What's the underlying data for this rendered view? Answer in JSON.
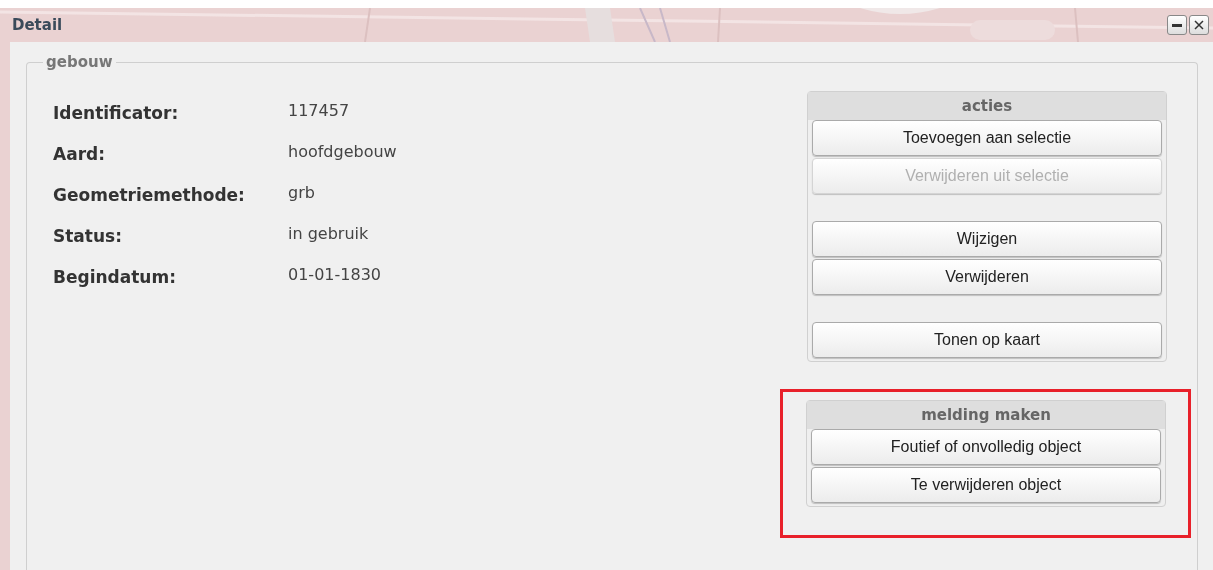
{
  "window": {
    "title": "Detail"
  },
  "fieldset": {
    "legend": "gebouw"
  },
  "properties": [
    {
      "label": "Identificator:",
      "value": "117457"
    },
    {
      "label": "Aard:",
      "value": "hoofdgebouw"
    },
    {
      "label": "Geometriemethode:",
      "value": "grb"
    },
    {
      "label": "Status:",
      "value": "in gebruik"
    },
    {
      "label": "Begindatum:",
      "value": "01-01-1830"
    }
  ],
  "panels": [
    {
      "title": "acties",
      "highlighted": false,
      "button_groups": [
        [
          {
            "label": "Toevoegen aan selectie",
            "disabled": false
          },
          {
            "label": "Verwijderen uit selectie",
            "disabled": true
          }
        ],
        [
          {
            "label": "Wijzigen",
            "disabled": false
          },
          {
            "label": "Verwijderen",
            "disabled": false
          }
        ],
        [
          {
            "label": "Tonen op kaart",
            "disabled": false
          }
        ]
      ]
    },
    {
      "title": "melding maken",
      "highlighted": true,
      "button_groups": [
        [
          {
            "label": "Foutief of onvolledig object",
            "disabled": false
          },
          {
            "label": "Te verwijderen object",
            "disabled": false
          }
        ]
      ]
    }
  ]
}
